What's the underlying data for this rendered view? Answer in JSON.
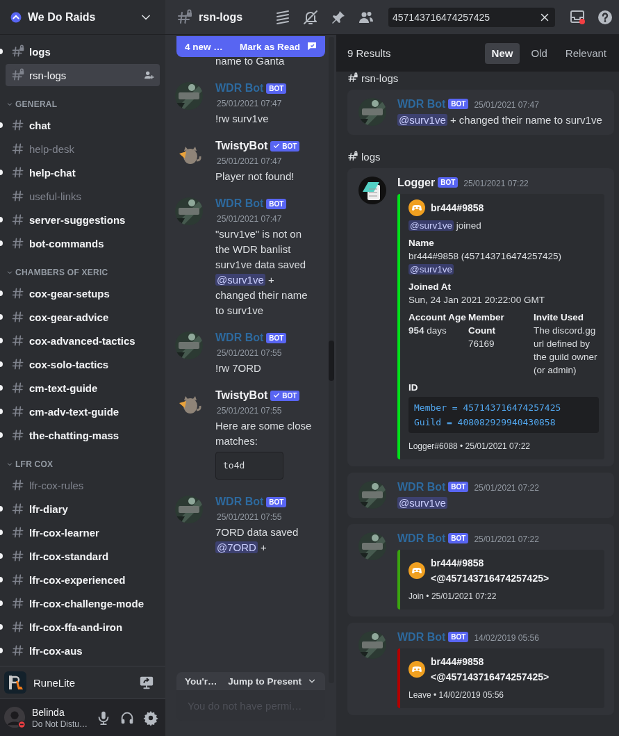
{
  "sidebar": {
    "server": "We Do Raids",
    "channels": [
      {
        "name": "logs",
        "locked": true,
        "unread": true,
        "selected": false
      },
      {
        "name": "rsn-logs",
        "locked": true,
        "unread": false,
        "selected": true
      }
    ],
    "categories": [
      {
        "name": "GENERAL",
        "channels": [
          {
            "name": "chat",
            "locked": false,
            "unread": true,
            "selected": false
          },
          {
            "name": "help-desk",
            "locked": false,
            "unread": false,
            "selected": false
          },
          {
            "name": "help-chat",
            "locked": false,
            "unread": true,
            "selected": false
          },
          {
            "name": "useful-links",
            "locked": false,
            "unread": false,
            "selected": false
          },
          {
            "name": "server-suggestions",
            "locked": false,
            "unread": true,
            "selected": false
          },
          {
            "name": "bot-commands",
            "locked": false,
            "unread": true,
            "selected": false
          }
        ]
      },
      {
        "name": "CHAMBERS OF XERIC",
        "channels": [
          {
            "name": "cox-gear-setups",
            "locked": false,
            "unread": true,
            "selected": false
          },
          {
            "name": "cox-gear-advice",
            "locked": false,
            "unread": true,
            "selected": false
          },
          {
            "name": "cox-advanced-tactics",
            "locked": false,
            "unread": true,
            "selected": false
          },
          {
            "name": "cox-solo-tactics",
            "locked": false,
            "unread": true,
            "selected": false
          },
          {
            "name": "cm-text-guide",
            "locked": false,
            "unread": true,
            "selected": false
          },
          {
            "name": "cm-adv-text-guide",
            "locked": false,
            "unread": true,
            "selected": false
          },
          {
            "name": "the-chatting-mass",
            "locked": false,
            "unread": true,
            "selected": false
          }
        ]
      },
      {
        "name": "LFR COX",
        "channels": [
          {
            "name": "lfr-cox-rules",
            "locked": false,
            "unread": false,
            "selected": false
          },
          {
            "name": "lfr-diary",
            "locked": false,
            "unread": true,
            "selected": false
          },
          {
            "name": "lfr-cox-learner",
            "locked": false,
            "unread": true,
            "selected": false
          },
          {
            "name": "lfr-cox-standard",
            "locked": false,
            "unread": true,
            "selected": false
          },
          {
            "name": "lfr-cox-experienced",
            "locked": false,
            "unread": true,
            "selected": false
          },
          {
            "name": "lfr-cox-challenge-mode",
            "locked": false,
            "unread": true,
            "selected": false
          },
          {
            "name": "lfr-cox-ffa-and-iron",
            "locked": false,
            "unread": true,
            "selected": false
          },
          {
            "name": "lfr-cox-aus",
            "locked": false,
            "unread": true,
            "selected": false
          }
        ]
      }
    ],
    "activity": {
      "app": "RuneLite"
    },
    "user": {
      "name": "Belinda",
      "status": "Do Not Distu…"
    }
  },
  "header": {
    "channel": "rsn-logs",
    "search_value": "457143716474257425"
  },
  "chat": {
    "banner": {
      "text": "4 new …",
      "action": "Mark as Read"
    },
    "messages": [
      {
        "kind": "continuation",
        "body": [
          {
            "kind": "text",
            "text": "name to Ganta"
          }
        ]
      },
      {
        "author": "WDR Bot",
        "color": "#2d6a9f",
        "kind": "emblem",
        "badge": "BOT",
        "verified": false,
        "time": "25/01/2021 07:47",
        "body": [
          {
            "kind": "text",
            "text": "!rw surv1ve"
          }
        ]
      },
      {
        "author": "TwistyBot",
        "color": "#f2f3f5",
        "kind": "cat",
        "badge": "BOT",
        "verified": true,
        "time": "25/01/2021 07:47",
        "body": [
          {
            "kind": "text",
            "text": "Player not found!"
          }
        ]
      },
      {
        "author": "WDR Bot",
        "color": "#2d6a9f",
        "kind": "emblem",
        "badge": "BOT",
        "verified": false,
        "time": "25/01/2021 07:47",
        "body": [
          {
            "kind": "text",
            "text": "\"surv1ve\" is not on the WDR banlist"
          },
          {
            "kind": "text",
            "text": "surv1ve data saved"
          },
          {
            "kind": "mention",
            "mention": "@surv1ve",
            "text": "+ changed their name to surv1ve"
          }
        ]
      },
      {
        "author": "WDR Bot",
        "color": "#2d6a9f",
        "kind": "emblem",
        "badge": "BOT",
        "verified": false,
        "time": "25/01/2021 07:55",
        "body": [
          {
            "kind": "text",
            "text": "!rw 7ORD"
          }
        ]
      },
      {
        "author": "TwistyBot",
        "color": "#f2f3f5",
        "kind": "cat",
        "badge": "BOT",
        "verified": true,
        "time": "25/01/2021 07:55",
        "body": [
          {
            "kind": "text",
            "text": "Here are some close matches:"
          },
          {
            "kind": "code",
            "lines": [
              "to4d"
            ]
          }
        ]
      },
      {
        "author": "WDR Bot",
        "color": "#2d6a9f",
        "kind": "emblem",
        "badge": "BOT",
        "verified": false,
        "time": "25/01/2021 07:55",
        "body": [
          {
            "kind": "text",
            "text": "7ORD data saved"
          },
          {
            "kind": "mention",
            "mention": "@7ORD",
            "text": "+"
          }
        ]
      }
    ],
    "jump_bar": {
      "text": "You'r…",
      "action": "Jump to Present"
    },
    "composer": {
      "placeholder": "You do not have permi…"
    }
  },
  "results": {
    "count": "9 Results",
    "sort_tabs": [
      {
        "label": "New",
        "selected": true
      },
      {
        "label": "Old",
        "selected": false
      },
      {
        "label": "Relevant",
        "selected": false
      }
    ],
    "groups": [
      {
        "channel": "rsn-logs",
        "items": [
          {
            "author": "WDR Bot",
            "color": "#2d6a9f",
            "kind": "emblem",
            "badge": "BOT",
            "verified": false,
            "time": "25/01/2021 07:47",
            "body": [
              {
                "kind": "mention",
                "mention": "@surv1ve",
                "text": "+ changed their name to surv1ve"
              }
            ]
          }
        ]
      },
      {
        "channel": "logs",
        "items": [
          {
            "author": "Logger",
            "color": "#f2f3f5",
            "kind": "notepad",
            "badge": "BOT",
            "verified": false,
            "time": "25/01/2021 07:22",
            "embeds": [
              {
                "color": "#00e01a",
                "author": "br444#9858",
                "description": [
                  {
                    "kind": "mention",
                    "mention": "@surv1ve",
                    "text": "joined"
                  }
                ],
                "fields": [
                  {
                    "name": "Name",
                    "inline": false,
                    "value": [
                      {
                        "kind": "text",
                        "text": "br444#9858 (457143716474257425)"
                      },
                      {
                        "kind": "mention",
                        "mention": "@surv1ve"
                      }
                    ]
                  },
                  {
                    "name": "Joined At",
                    "inline": false,
                    "value": [
                      {
                        "kind": "text",
                        "text": "Sun, 24 Jan 2021 20:22:00 GMT"
                      }
                    ]
                  },
                  {
                    "name": "Account Age",
                    "inline": true,
                    "value": [
                      {
                        "kind": "text",
                        "text": "**954** days"
                      }
                    ]
                  },
                  {
                    "name": "Member Count",
                    "inline": true,
                    "value": [
                      {
                        "kind": "text",
                        "text": "76169"
                      }
                    ]
                  },
                  {
                    "name": "Invite Used",
                    "inline": true,
                    "value": [
                      {
                        "kind": "text",
                        "text": "The discord.gg url defined by the guild owner (or admin)"
                      }
                    ]
                  },
                  {
                    "name": "ID",
                    "inline": false,
                    "value": [
                      {
                        "kind": "code",
                        "lines": [
                          "Member = 457143716474257425",
                          "Guild = 408082929940430858"
                        ]
                      }
                    ]
                  }
                ],
                "footer": "Logger#6088 • 25/01/2021 07:22"
              }
            ]
          },
          {
            "author": "WDR Bot",
            "color": "#2d6a9f",
            "kind": "emblem",
            "badge": "BOT",
            "verified": false,
            "time": "25/01/2021 07:22",
            "body": [
              {
                "kind": "mention",
                "mention": "@surv1ve"
              }
            ]
          },
          {
            "author": "WDR Bot",
            "color": "#2d6a9f",
            "kind": "emblem",
            "badge": "BOT",
            "verified": false,
            "time": "25/01/2021 07:22",
            "embeds": [
              {
                "color": "#3aa40f",
                "author": "br444#9858 <@457143716474257425>",
                "footer": "Join • 25/01/2021 07:22"
              }
            ]
          },
          {
            "author": "WDR Bot",
            "color": "#2d6a9f",
            "kind": "emblem",
            "badge": "BOT",
            "verified": false,
            "time": "14/02/2019 05:56",
            "embeds": [
              {
                "color": "#b30000",
                "author": "br444#9858 <@457143716474257425>",
                "footer": "Leave • 14/02/2019 05:56"
              }
            ]
          }
        ]
      }
    ]
  }
}
